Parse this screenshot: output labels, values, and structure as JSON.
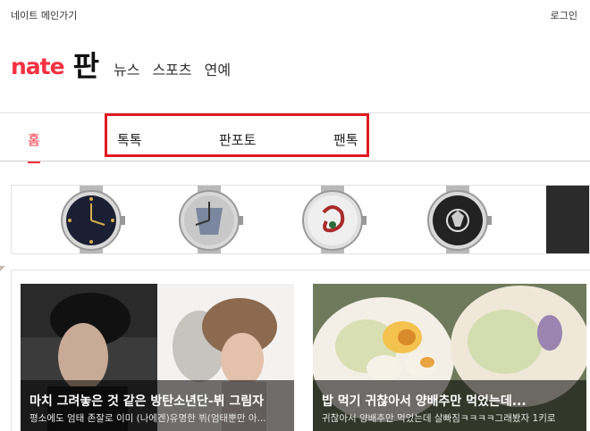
{
  "topbar": {
    "home_link": "네이트 메인가기",
    "login": "로그인"
  },
  "header": {
    "logo_brand": "nate",
    "logo_service": "판",
    "gnb": [
      "뉴스",
      "스포츠",
      "연예"
    ]
  },
  "tabs": [
    {
      "label": "홈",
      "active": true
    },
    {
      "label": "톡톡",
      "active": false
    },
    {
      "label": "판포토",
      "active": false
    },
    {
      "label": "팬톡",
      "active": false
    }
  ],
  "colors": {
    "brand": "#f43142",
    "highlight_box": "#e11b22"
  },
  "cards": [
    {
      "title": "마치 그려놓은 것 같은 방탄소년단-뷔 그림자",
      "desc": "평소에도 엄태 존잘로 이미 (나에겐)유명한 뷔(엄태뿐만 아..."
    },
    {
      "title": "밥 먹기 귀찮아서 양배추만 먹었는데...",
      "desc": "귀찮아서 양배추만 먹었는데 살빠짐ㅋㅋㅋㅋ그래봤자 1키로"
    }
  ]
}
